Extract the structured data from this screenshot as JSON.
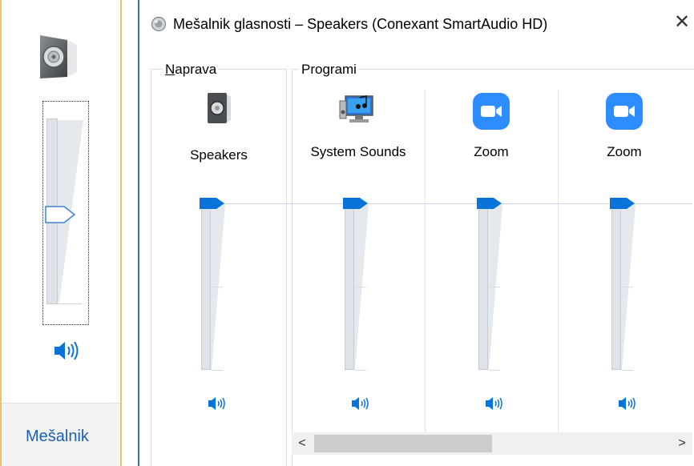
{
  "flyout": {
    "mixer_link": "Mešalnik",
    "volume_level": 0.5
  },
  "window": {
    "title": "Mešalnik glasnosti – Speakers (Conexant SmartAudio HD)",
    "close_glyph": "✕",
    "device_group_label": "Naprava",
    "device_group_label_rest": "aprava",
    "device_group_label_key": "N",
    "apps_group_label": "Programi"
  },
  "channels": [
    {
      "name": "Speakers",
      "icon": "speaker-device-icon",
      "volume_level": 1.0,
      "muted": false
    },
    {
      "name": "System Sounds",
      "icon": "system-sounds-icon",
      "volume_level": 1.0,
      "muted": false
    },
    {
      "name": "Zoom",
      "icon": "zoom-icon",
      "volume_level": 1.0,
      "muted": false
    },
    {
      "name": "Zoom",
      "icon": "zoom-icon",
      "volume_level": 1.0,
      "muted": false
    }
  ],
  "scrollbar": {
    "left_glyph": "<",
    "right_glyph": ">"
  },
  "colors": {
    "accent": "#0a73d9",
    "zoom": "#2d8cff",
    "flyout_border": "#f0c070",
    "window_border": "#3c6ea8"
  }
}
